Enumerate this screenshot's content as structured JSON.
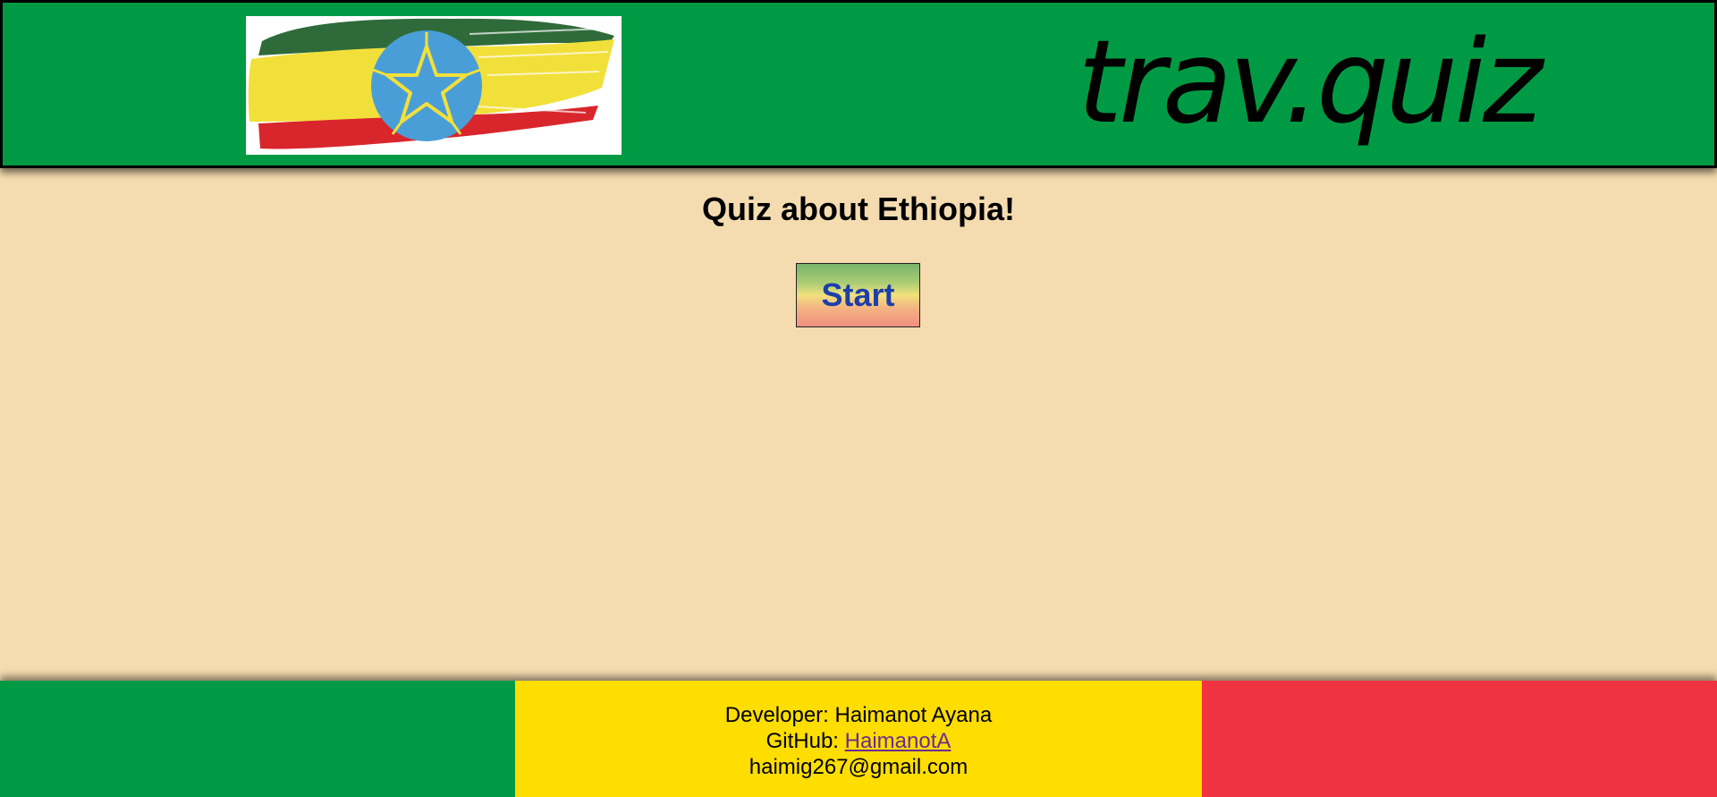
{
  "header": {
    "site_title": "trav.quiz",
    "logo_icon": "ethiopia-flag-brush-icon",
    "colors": {
      "background": "#009a44",
      "border": "#000000"
    }
  },
  "main": {
    "heading": "Quiz about Ethiopia!",
    "start_label": "Start",
    "colors": {
      "background": "#f5dcb0",
      "button_text": "#1d3fa8"
    }
  },
  "footer": {
    "developer_prefix": "Developer:",
    "developer_name": "Haimanot Ayana",
    "github_prefix": "GitHub:",
    "github_link_text": "HaimanotA",
    "email": "haimig267@gmail.com",
    "colors": {
      "left": "#009a44",
      "center": "#fedd00",
      "right": "#ef3340"
    }
  }
}
